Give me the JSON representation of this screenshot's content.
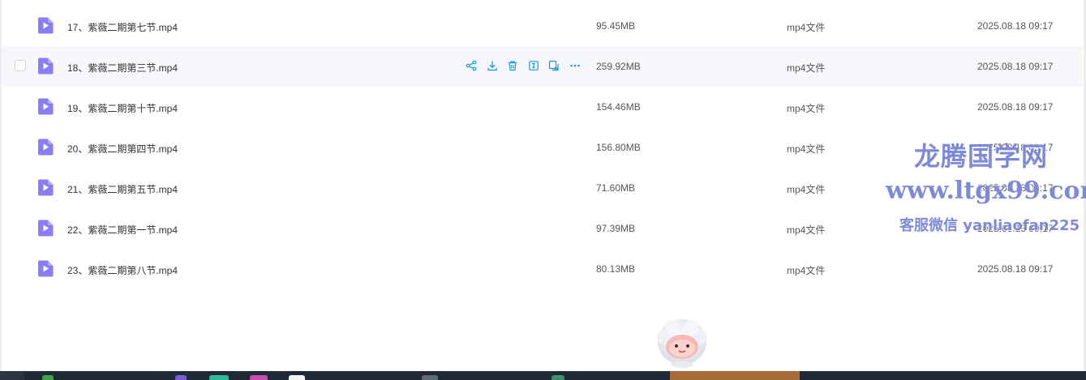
{
  "files": [
    {
      "name": "17、紫薇二期第七节.mp4",
      "size": "95.45MB",
      "type": "mp4文件",
      "date": "2025.08.18 09:17",
      "hovered": false
    },
    {
      "name": "18、紫薇二期第三节.mp4",
      "size": "259.92MB",
      "type": "mp4文件",
      "date": "2025.08.18 09:17",
      "hovered": true
    },
    {
      "name": "19、紫薇二期第十节.mp4",
      "size": "154.46MB",
      "type": "mp4文件",
      "date": "2025.08.18 09:17",
      "hovered": false
    },
    {
      "name": "20、紫薇二期第四节.mp4",
      "size": "156.80MB",
      "type": "mp4文件",
      "date": "2025.08.18 09:17",
      "hovered": false
    },
    {
      "name": "21、紫薇二期第五节.mp4",
      "size": "71.60MB",
      "type": "mp4文件",
      "date": "2025.08.18 09:17",
      "hovered": false
    },
    {
      "name": "22、紫薇二期第一节.mp4",
      "size": "97.39MB",
      "type": "mp4文件",
      "date": "2025.08.18 09:17",
      "hovered": false
    },
    {
      "name": "23、紫薇二期第八节.mp4",
      "size": "80.13MB",
      "type": "mp4文件",
      "date": "2025.08.18 09:17",
      "hovered": false
    }
  ],
  "row_actions": [
    "share-icon",
    "download-icon",
    "delete-icon",
    "rename-icon",
    "copy-icon",
    "more-icon"
  ],
  "watermark": {
    "title": "龙腾国学网",
    "site": "www.ltgx99.com",
    "contact": "客服微信 yanliaofan225"
  },
  "colors": {
    "file_icon": "#8b7cf6",
    "action_icon": "#1a9bd7",
    "row_hover": "#f5f7fa",
    "watermark": "#5a69cd",
    "taskbar": "#1f2a36"
  }
}
